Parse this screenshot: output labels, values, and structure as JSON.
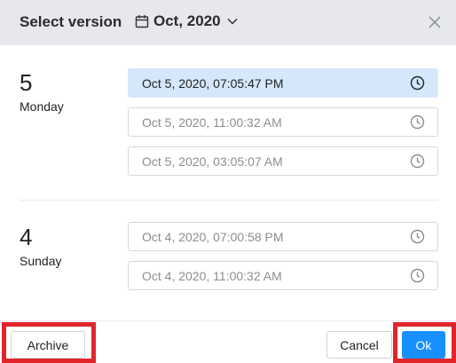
{
  "dialog": {
    "title": "Select version",
    "month": "Oct, 2020"
  },
  "groups": [
    {
      "day_number": "5",
      "weekday": "Monday",
      "versions": [
        {
          "label": "Oct 5, 2020, 07:05:47 PM",
          "selected": true
        },
        {
          "label": "Oct 5, 2020, 11:00:32 AM",
          "selected": false
        },
        {
          "label": "Oct 5, 2020, 03:05:07 AM",
          "selected": false
        }
      ]
    },
    {
      "day_number": "4",
      "weekday": "Sunday",
      "versions": [
        {
          "label": "Oct 4, 2020, 07:00:58 PM",
          "selected": false
        },
        {
          "label": "Oct 4, 2020, 11:00:32 AM",
          "selected": false
        }
      ]
    }
  ],
  "footer": {
    "archive_label": "Archive",
    "cancel_label": "Cancel",
    "ok_label": "Ok"
  },
  "colors": {
    "accent": "#1890ff",
    "selected_bg": "#d4e7fb",
    "highlight": "#e0262b",
    "header_bg": "#e6e8ec"
  }
}
